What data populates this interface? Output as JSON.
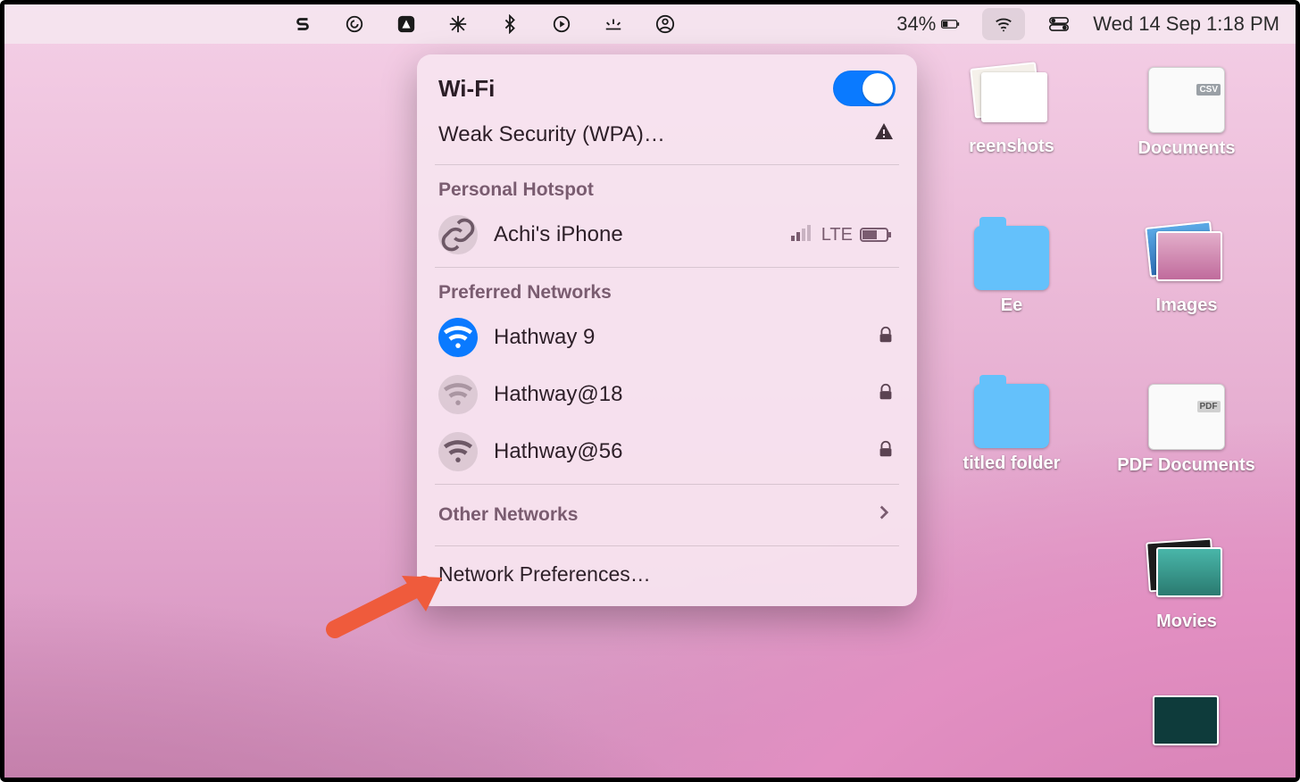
{
  "menubar": {
    "battery_pct": "34%",
    "clock": "Wed 14 Sep  1:18 PM"
  },
  "panel": {
    "title": "Wi-Fi",
    "weak_security": "Weak Security (WPA)…",
    "hotspot_header": "Personal Hotspot",
    "hotspot_name": "Achi's iPhone",
    "hotspot_net_type": "LTE",
    "preferred_header": "Preferred Networks",
    "networks": [
      {
        "name": "Hathway 9",
        "connected": true
      },
      {
        "name": "Hathway@18",
        "connected": false
      },
      {
        "name": "Hathway@56",
        "connected": false
      }
    ],
    "other_networks": "Other Networks",
    "preferences": "Network Preferences…"
  },
  "desktop_icons": [
    {
      "label": "reenshots",
      "kind": "screenshots_stack"
    },
    {
      "label": "Documents",
      "kind": "csv_paper"
    },
    {
      "label": "Ee",
      "kind": "folder"
    },
    {
      "label": "Images",
      "kind": "image_stack"
    },
    {
      "label": "titled folder",
      "kind": "folder"
    },
    {
      "label": "PDF Documents",
      "kind": "pdf_paper"
    },
    {
      "label": "Movies",
      "kind": "movie_stack"
    }
  ]
}
